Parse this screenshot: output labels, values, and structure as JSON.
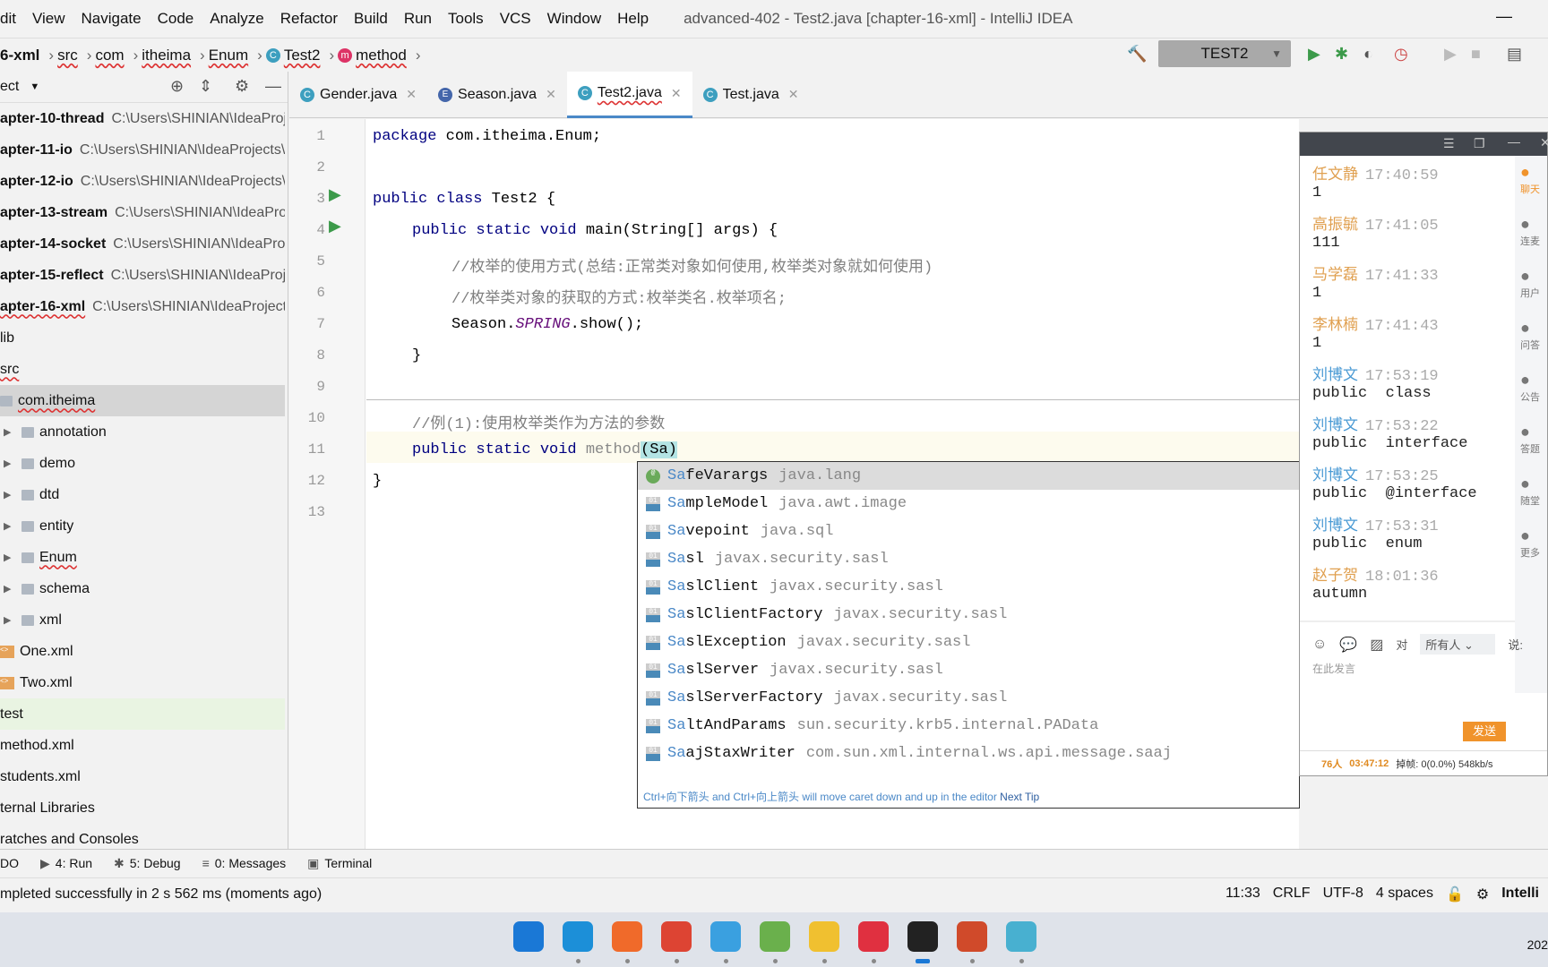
{
  "menu": [
    "dit",
    "View",
    "Navigate",
    "Code",
    "Analyze",
    "Refactor",
    "Build",
    "Run",
    "Tools",
    "VCS",
    "Window",
    "Help"
  ],
  "window_title": "advanced-402 - Test2.java [chapter-16-xml] - IntelliJ IDEA",
  "breadcrumb": [
    "6-xml",
    "src",
    "com",
    "itheima",
    "Enum",
    "Test2",
    "method"
  ],
  "run_config": "TEST2",
  "project_header": "ect",
  "tree": [
    {
      "label": "apter-10-thread",
      "path": "C:\\Users\\SHINIAN\\IdeaProj"
    },
    {
      "label": "apter-11-io",
      "path": "C:\\Users\\SHINIAN\\IdeaProjects\\"
    },
    {
      "label": "apter-12-io",
      "path": "C:\\Users\\SHINIAN\\IdeaProjects\\"
    },
    {
      "label": "apter-13-stream",
      "path": "C:\\Users\\SHINIAN\\IdeaProj"
    },
    {
      "label": "apter-14-socket",
      "path": "C:\\Users\\SHINIAN\\IdeaProj"
    },
    {
      "label": "apter-15-reflect",
      "path": "C:\\Users\\SHINIAN\\IdeaProj"
    },
    {
      "label": "apter-16-xml",
      "path": "C:\\Users\\SHINIAN\\IdeaProject"
    },
    {
      "label": "lib"
    },
    {
      "label": "src"
    },
    {
      "label": "com.itheima"
    },
    {
      "label": "annotation"
    },
    {
      "label": "demo"
    },
    {
      "label": "dtd"
    },
    {
      "label": "entity"
    },
    {
      "label": "Enum"
    },
    {
      "label": "schema"
    },
    {
      "label": "xml"
    },
    {
      "label": "One.xml"
    },
    {
      "label": "Two.xml"
    },
    {
      "label": "test"
    },
    {
      "label": "method.xml"
    },
    {
      "label": "students.xml"
    },
    {
      "label": "ternal Libraries"
    },
    {
      "label": "ratches and Consoles"
    }
  ],
  "tabs": [
    {
      "label": "Gender.java",
      "icon": "C"
    },
    {
      "label": "Season.java",
      "icon": "E"
    },
    {
      "label": "Test2.java",
      "icon": "C"
    },
    {
      "label": "Test.java",
      "icon": "C"
    }
  ],
  "code": {
    "l1": [
      "package",
      " com.itheima.Enum;"
    ],
    "l3": [
      "public class",
      " Test2 {"
    ],
    "l4": [
      "public static void",
      " main(String[] args) {"
    ],
    "l5": "//枚举的使用方式(总结:正常类对象如何使用,枚举类对象就如何使用)",
    "l6": "//枚举类对象的获取的方式:枚举类名.枚举项名;",
    "l7": [
      "Season.",
      "SPRING",
      ".show();"
    ],
    "l8": "}",
    "l10": "//例(1):使用枚举类作为方法的参数",
    "l11": [
      "public static void",
      " ",
      "method",
      "(Sa)"
    ],
    "l12": "}"
  },
  "line_numbers": [
    "1",
    "2",
    "3",
    "4",
    "5",
    "6",
    "7",
    "8",
    "9",
    "10",
    "11",
    "12",
    "13"
  ],
  "completion": {
    "typed": "Sa",
    "items": [
      {
        "rest": "feVarargs",
        "pkg": "java.lang",
        "icon": "annotation"
      },
      {
        "rest": "mpleModel",
        "pkg": "java.awt.image",
        "icon": "class"
      },
      {
        "rest": "vepoint",
        "pkg": "java.sql",
        "icon": "class"
      },
      {
        "rest": "sl",
        "pkg": "javax.security.sasl",
        "icon": "class"
      },
      {
        "rest": "slClient",
        "pkg": "javax.security.sasl",
        "icon": "class"
      },
      {
        "rest": "slClientFactory",
        "pkg": "javax.security.sasl",
        "icon": "class"
      },
      {
        "rest": "slException",
        "pkg": "javax.security.sasl",
        "icon": "class"
      },
      {
        "rest": "slServer",
        "pkg": "javax.security.sasl",
        "icon": "class"
      },
      {
        "rest": "slServerFactory",
        "pkg": "javax.security.sasl",
        "icon": "class"
      },
      {
        "rest": "ltAndParams",
        "pkg": "sun.security.krb5.internal.PAData",
        "icon": "class"
      },
      {
        "rest": "ajStaxWriter",
        "pkg": "com.sun.xml.internal.ws.api.message.saaj",
        "icon": "class"
      }
    ],
    "tip": "Ctrl+向下箭头 and Ctrl+向上箭头 will move caret down and up in the editor",
    "next_tip": "Next Tip"
  },
  "chat": {
    "messages": [
      {
        "name": "任文静",
        "time": "17:40:59",
        "text": "1",
        "color": "orange"
      },
      {
        "name": "高振毓",
        "time": "17:41:05",
        "text": "111",
        "color": "orange"
      },
      {
        "name": "马学磊",
        "time": "17:41:33",
        "text": "1",
        "color": "orange"
      },
      {
        "name": "李林楠",
        "time": "17:41:43",
        "text": "1",
        "color": "orange"
      },
      {
        "name": "刘博文",
        "time": "17:53:19",
        "text": "public  class",
        "color": "blue"
      },
      {
        "name": "刘博文",
        "time": "17:53:22",
        "text": "public  interface",
        "color": "blue"
      },
      {
        "name": "刘博文",
        "time": "17:53:25",
        "text": "public  @interface",
        "color": "blue"
      },
      {
        "name": "刘博文",
        "time": "17:53:31",
        "text": "public  enum",
        "color": "blue"
      },
      {
        "name": "赵子贺",
        "time": "18:01:36",
        "text": "autumn",
        "color": "orange"
      }
    ],
    "side": [
      "聊天",
      "连麦",
      "用户",
      "问答",
      "公告",
      "答题",
      "随堂",
      "更多"
    ],
    "to_label": "对",
    "to_value": "所有人",
    "say": "说:",
    "placeholder": "在此发言",
    "send": "发送",
    "people": "76人",
    "duration": "03:47:12",
    "dropped": "掉帧: 0(0.0%) 548kb/s"
  },
  "toolwindows": [
    "DO",
    "4: Run",
    "5: Debug",
    "0: Messages",
    "Terminal"
  ],
  "status": {
    "message": "mpleted successfully in 2 s 562 ms (moments ago)",
    "pos": "11:33",
    "eol": "CRLF",
    "enc": "UTF-8",
    "indent": "4 spaces",
    "brand": "Intelli"
  },
  "clock": "202"
}
